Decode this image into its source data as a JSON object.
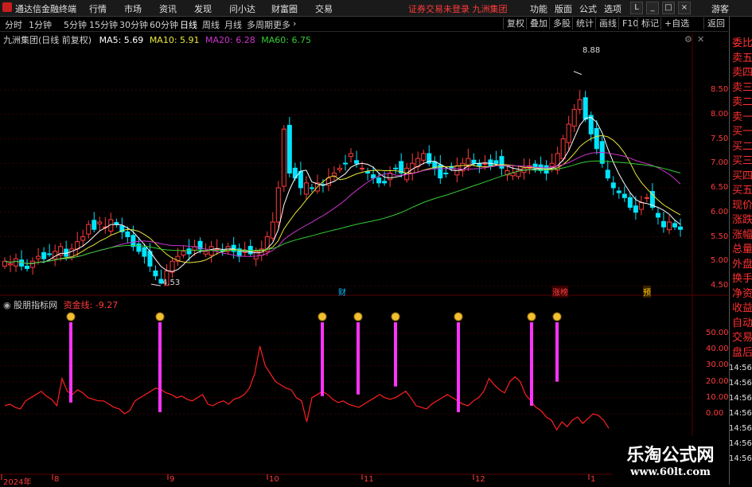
{
  "app": {
    "title": "通达信金融终端",
    "notice": "证券交易未登录  九洲集团",
    "guest": "游客"
  },
  "menu": [
    "行情",
    "市场",
    "资讯",
    "发现",
    "问小达",
    "财富圈",
    "交易"
  ],
  "right_menu": [
    "功能",
    "版面",
    "公式",
    "选项"
  ],
  "window_buttons": [
    "L",
    "_",
    "□",
    "×"
  ],
  "periods": [
    "分时",
    "1分钟",
    "5分钟",
    "15分钟",
    "30分钟",
    "60分钟",
    "日线",
    "周线",
    "月线",
    "多周期",
    "更多"
  ],
  "active_period": "日线",
  "tools": [
    "复权",
    "叠加",
    "多股",
    "统计",
    "画线",
    "F10",
    "标记",
    "+自选",
    "返回"
  ],
  "main": {
    "stock": "九洲集团(日线 前复权)",
    "ma5": "MA5: 5.69",
    "ma10": "MA10: 5.91",
    "ma20": "MA20: 6.28",
    "ma60": "MA60: 6.75",
    "high_label": "8.88",
    "low_label": "4.53",
    "markers": [
      "财",
      "涨榜",
      "预"
    ],
    "y_ticks": [
      "8.50",
      "8.00",
      "7.50",
      "7.00",
      "6.50",
      "6.00",
      "5.50",
      "5.00",
      "4.50"
    ]
  },
  "indicator": {
    "name": "股朋指标网",
    "line_label": "资金线: -9.27",
    "y_ticks": [
      "50.00",
      "40.00",
      "30.00",
      "20.00",
      "10.00",
      "0.00"
    ],
    "right_extra": [
      "14:56",
      "14:56",
      "14:56",
      "14:56",
      "14:56",
      "14:56",
      "14:56"
    ]
  },
  "x_axis": [
    "2024年",
    "8",
    "9",
    "10",
    "11",
    "12",
    "1"
  ],
  "side_panel": [
    "委比",
    "卖五",
    "卖四",
    "卖三",
    "卖二",
    "卖一",
    "买一",
    "买二",
    "买三",
    "买四",
    "买五",
    "现价",
    "涨跌",
    "涨幅",
    "总量",
    "外盘",
    "换手",
    "净资",
    "收益",
    "自动",
    "交易",
    "盘后"
  ],
  "watermark": {
    "title": "乐淘公式网",
    "url": "www.60lt.com"
  },
  "colors": {
    "up": "#ff3b3b",
    "down": "#00e5ff",
    "ma5": "#ffffff",
    "ma10": "#e8e83a",
    "ma20": "#cc33cc",
    "ma60": "#33cc33",
    "signal": "#ff33ff"
  }
}
